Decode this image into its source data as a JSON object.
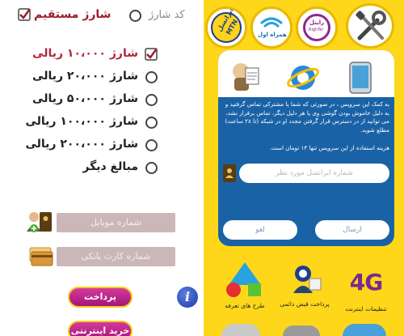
{
  "left": {
    "direct_charge": "شارژ مستقیم",
    "pin_charge": "کد شارژ",
    "amounts": [
      {
        "label": "شارژ ۱۰،۰۰۰ ریالی",
        "selected": true
      },
      {
        "label": "شارژ ۲۰،۰۰۰ ریالی",
        "selected": false
      },
      {
        "label": "شارژ ۵۰،۰۰۰ ریالی",
        "selected": false
      },
      {
        "label": "شارژ ۱۰۰،۰۰۰ ریالی",
        "selected": false
      },
      {
        "label": "شارژ ۲۰۰،۰۰۰ ریالی",
        "selected": false
      },
      {
        "label": "مبالغ دیگر",
        "selected": false
      }
    ],
    "mobile_placeholder": "شماره موبایل",
    "card_placeholder": "شماره کارت بانکی",
    "pay_label": "پرداخت",
    "online_buy_label": "خرید اینترنتی",
    "info_label": "i"
  },
  "right": {
    "operators": [
      {
        "name": "ایرانسل",
        "sub": "MTN"
      },
      {
        "name": "همراه اول",
        "sub": ""
      },
      {
        "name": "رایتل",
        "sub": "RighTel"
      }
    ],
    "notice": "به کمک این سرویس ، در صورتی که شما یا مشترکی تماس گرفتید و به دلیل خاموش بودن گوشی وی یا هر دلیل دیگر، تماس برقرار نشد، می توانید از در دسترس قرار گرفتن مجدد او در شبکه (تا ۲۸ ساعت) مطلع شوید.",
    "cost_note": "هزینه استفاده از این سرویس تنها ۱۳ تومان است.",
    "number_placeholder": "شماره ایرانسل مورد نظر",
    "send_label": "ارسال",
    "cancel_label": "لغو",
    "services": [
      {
        "label": "تنظیمات اینترنت"
      },
      {
        "label": "پرداخت قبض دائمی"
      },
      {
        "label": "طرح های تعرفه"
      }
    ],
    "badge_4g": "4G",
    "colors": {
      "panel": "#ffd71a",
      "card": "#1a62a6",
      "accent": "#b0273a"
    }
  }
}
